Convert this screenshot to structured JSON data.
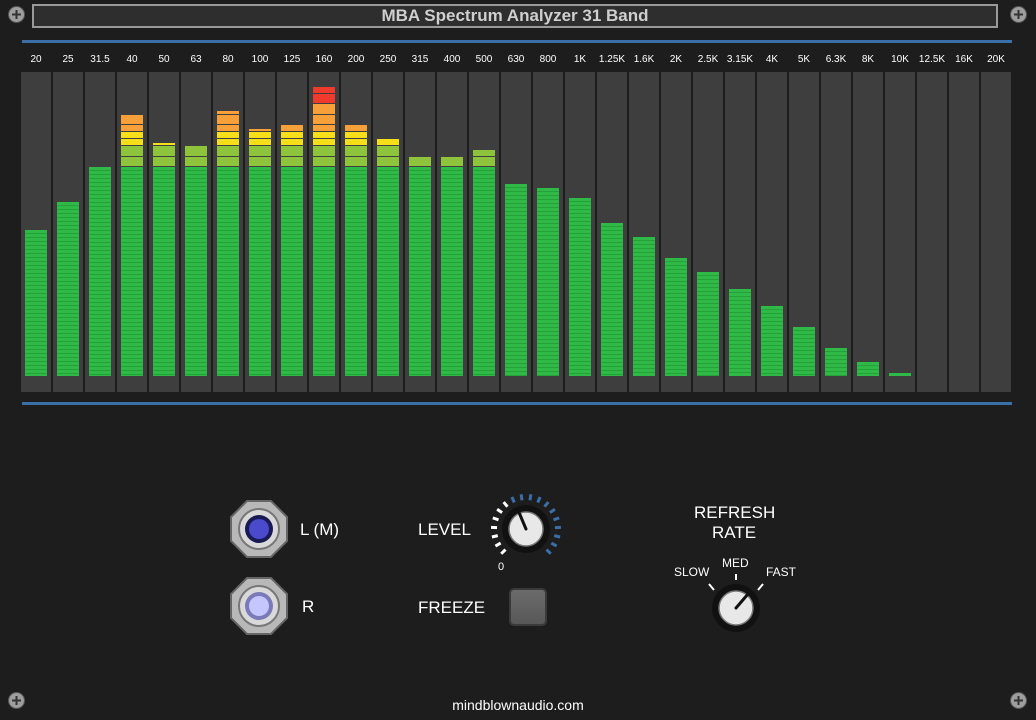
{
  "title": "MBA Spectrum Analyzer 31 Band",
  "bands": [
    "20",
    "25",
    "31.5",
    "40",
    "50",
    "63",
    "80",
    "100",
    "125",
    "160",
    "200",
    "250",
    "315",
    "400",
    "500",
    "630",
    "800",
    "1K",
    "1.25K",
    "1.6K",
    "2K",
    "2.5K",
    "3.15K",
    "4K",
    "5K",
    "6.3K",
    "8K",
    "10K",
    "12.5K",
    "16K",
    "20K"
  ],
  "levels": [
    0.42,
    0.5,
    0.6,
    0.75,
    0.67,
    0.66,
    0.76,
    0.71,
    0.72,
    0.83,
    0.72,
    0.68,
    0.63,
    0.63,
    0.65,
    0.55,
    0.54,
    0.51,
    0.44,
    0.4,
    0.34,
    0.3,
    0.25,
    0.2,
    0.14,
    0.08,
    0.04,
    0.01,
    0,
    0,
    0
  ],
  "colors": {
    "accent_rule": "#3a6fa8",
    "green": "#2fb947",
    "lime": "#8dc43c",
    "yellow": "#f6df19",
    "orange": "#f7a03a",
    "red": "#ef3b2d",
    "column_bg": "#3e3e3e"
  },
  "inputs": {
    "left_label": "L (M)",
    "right_label": "R"
  },
  "level": {
    "label": "LEVEL",
    "zero_label": "0"
  },
  "freeze": {
    "label": "FREEZE"
  },
  "refresh": {
    "label_line1": "REFRESH",
    "label_line2": "RATE",
    "slow": "SLOW",
    "med": "MED",
    "fast": "FAST"
  },
  "footer": "mindblownaudio.com",
  "icons": [
    "screw-icon",
    "jack-icon",
    "knob-icon"
  ]
}
